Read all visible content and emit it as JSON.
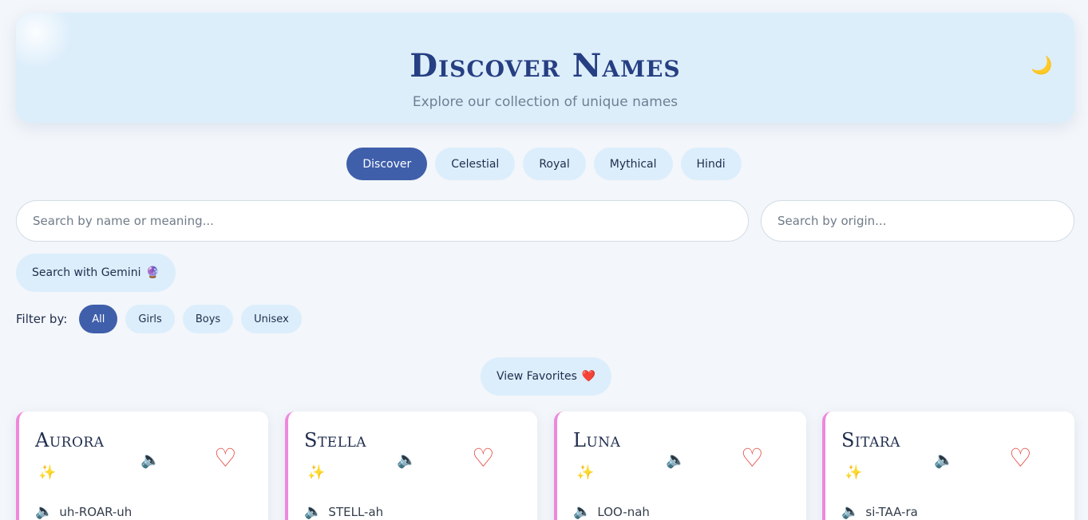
{
  "hero": {
    "title": "Discover Names",
    "subtitle": "Explore our collection of unique names",
    "theme_icon": "🌙"
  },
  "tabs": [
    {
      "label": "Discover",
      "active": true
    },
    {
      "label": "Celestial",
      "active": false
    },
    {
      "label": "Royal",
      "active": false
    },
    {
      "label": "Mythical",
      "active": false
    },
    {
      "label": "Hindi",
      "active": false
    }
  ],
  "search": {
    "name_placeholder": "Search by name or meaning...",
    "origin_placeholder": "Search by origin...",
    "gemini_label": "Search with Gemini",
    "gemini_icon": "🔮"
  },
  "filter": {
    "label": "Filter by:",
    "options": [
      {
        "label": "All",
        "active": true
      },
      {
        "label": "Girls",
        "active": false
      },
      {
        "label": "Boys",
        "active": false
      },
      {
        "label": "Unisex",
        "active": false
      }
    ]
  },
  "favorites": {
    "label": "View Favorites",
    "icon": "❤️"
  },
  "cards": [
    {
      "name": "Aurora",
      "pronunciation": "uh-ROAR-uh",
      "spark": "✨",
      "speaker": "🔈",
      "heart": "♡"
    },
    {
      "name": "Stella",
      "pronunciation": "STELL-ah",
      "spark": "✨",
      "speaker": "🔈",
      "heart": "♡"
    },
    {
      "name": "Luna",
      "pronunciation": "LOO-nah",
      "spark": "✨",
      "speaker": "🔈",
      "heart": "♡"
    },
    {
      "name": "Sitara",
      "pronunciation": "si-TAA-ra",
      "spark": "✨",
      "speaker": "🔈",
      "heart": "♡"
    }
  ],
  "colors": {
    "accent": "#3f5fab",
    "chip_bg": "#dceefb",
    "card_border": "#ee88dc",
    "heart": "#e2433b",
    "background": "#f3f6fa"
  }
}
